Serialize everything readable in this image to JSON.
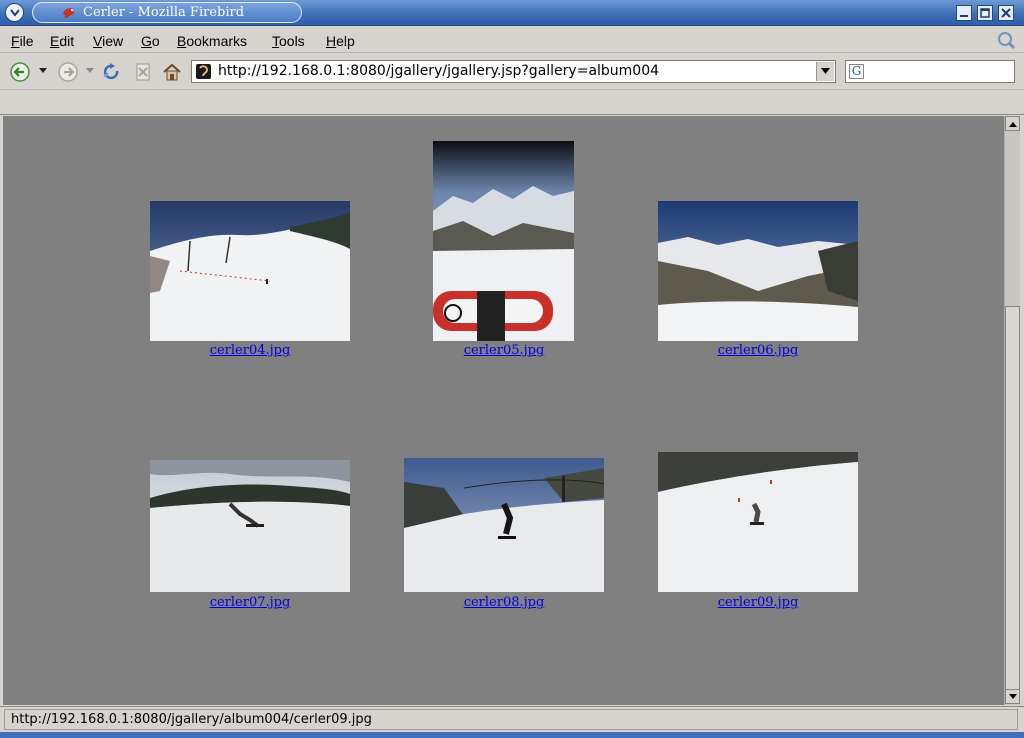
{
  "window": {
    "title": "Cerler - Mozilla Firebird"
  },
  "menubar": {
    "items": [
      {
        "label": "File"
      },
      {
        "label": "Edit"
      },
      {
        "label": "View"
      },
      {
        "label": "Go"
      },
      {
        "label": "Bookmarks"
      },
      {
        "label": "Tools"
      },
      {
        "label": "Help"
      }
    ]
  },
  "toolbar": {
    "buttons": [
      "back-icon",
      "forward-icon",
      "reload-icon",
      "stop-icon",
      "home-icon"
    ]
  },
  "urlbar": {
    "value": "http://192.168.0.1:8080/jgallery/jgallery.jsp?gallery=album004"
  },
  "search": {
    "engine_icon": "G",
    "value": ""
  },
  "gallery": {
    "colors": {
      "background": "#808080",
      "link": "#0000ee"
    },
    "items": [
      {
        "filename": "cerler04.jpg"
      },
      {
        "filename": "cerler05.jpg"
      },
      {
        "filename": "cerler06.jpg"
      },
      {
        "filename": "cerler07.jpg"
      },
      {
        "filename": "cerler08.jpg"
      },
      {
        "filename": "cerler09.jpg"
      }
    ]
  },
  "statusbar": {
    "text": "http://192.168.0.1:8080/jgallery/album004/cerler09.jpg"
  }
}
